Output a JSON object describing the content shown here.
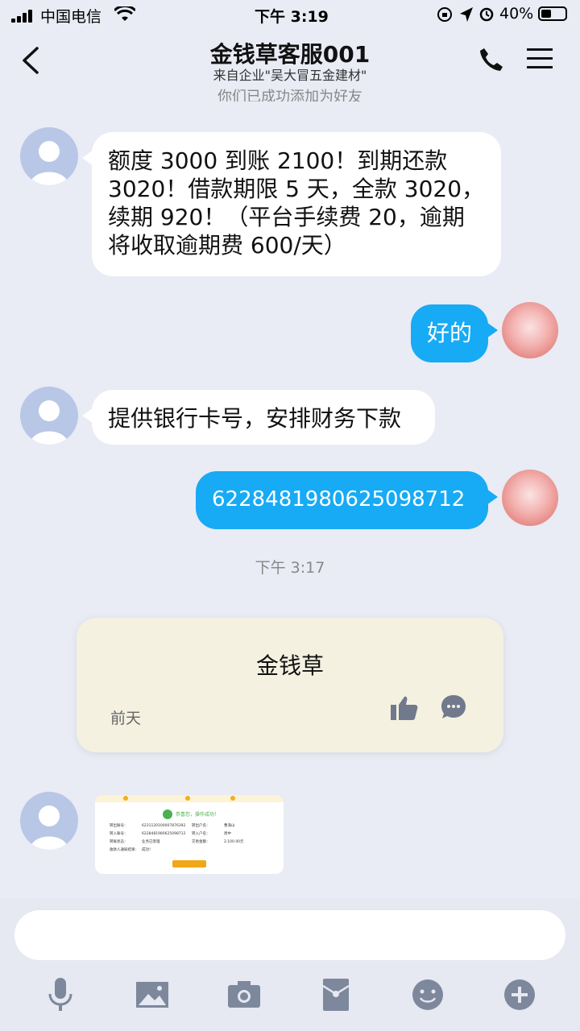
{
  "status_bar": {
    "carrier": "中国电信",
    "time": "下午 3:19",
    "battery": "40%"
  },
  "header": {
    "title": "金钱草客服001",
    "subtitle": "来自企业\"吴大冒五金建材\""
  },
  "system_message": "你们已成功添加为好友",
  "messages": [
    {
      "side": "left",
      "text": "额度 3000 到账 2100！到期还款 3020！借款期限 5 天，全款 3020，续期 920！（平台手续费 20，逾期将收取逾期费 600/天）"
    },
    {
      "side": "right",
      "text": "好的"
    },
    {
      "side": "left",
      "text": "提供银行卡号，安排财务下款"
    },
    {
      "side": "right",
      "text": "6228481980625098712"
    }
  ],
  "timestamp": "下午 3:17",
  "card": {
    "title": "金钱草",
    "date": "前天"
  },
  "receipt": {
    "success_text": "恭喜您，操作成功！",
    "rows": [
      [
        "转出账号：",
        "6231120100007876392",
        "转出户名：",
        "曹海山"
      ],
      [
        "转入账号：",
        "6228481980625098712",
        "转入户名：",
        "周中"
      ],
      [
        "转账状态：",
        "业务已受理",
        "交易金额：",
        "2,100.00元"
      ],
      [
        "收款人通知结果：",
        "成功！",
        "",
        ""
      ]
    ]
  },
  "colors": {
    "accent_blue": "#17aaf5",
    "background": "#e9ebf5",
    "card_bg": "#f4f1e1"
  }
}
